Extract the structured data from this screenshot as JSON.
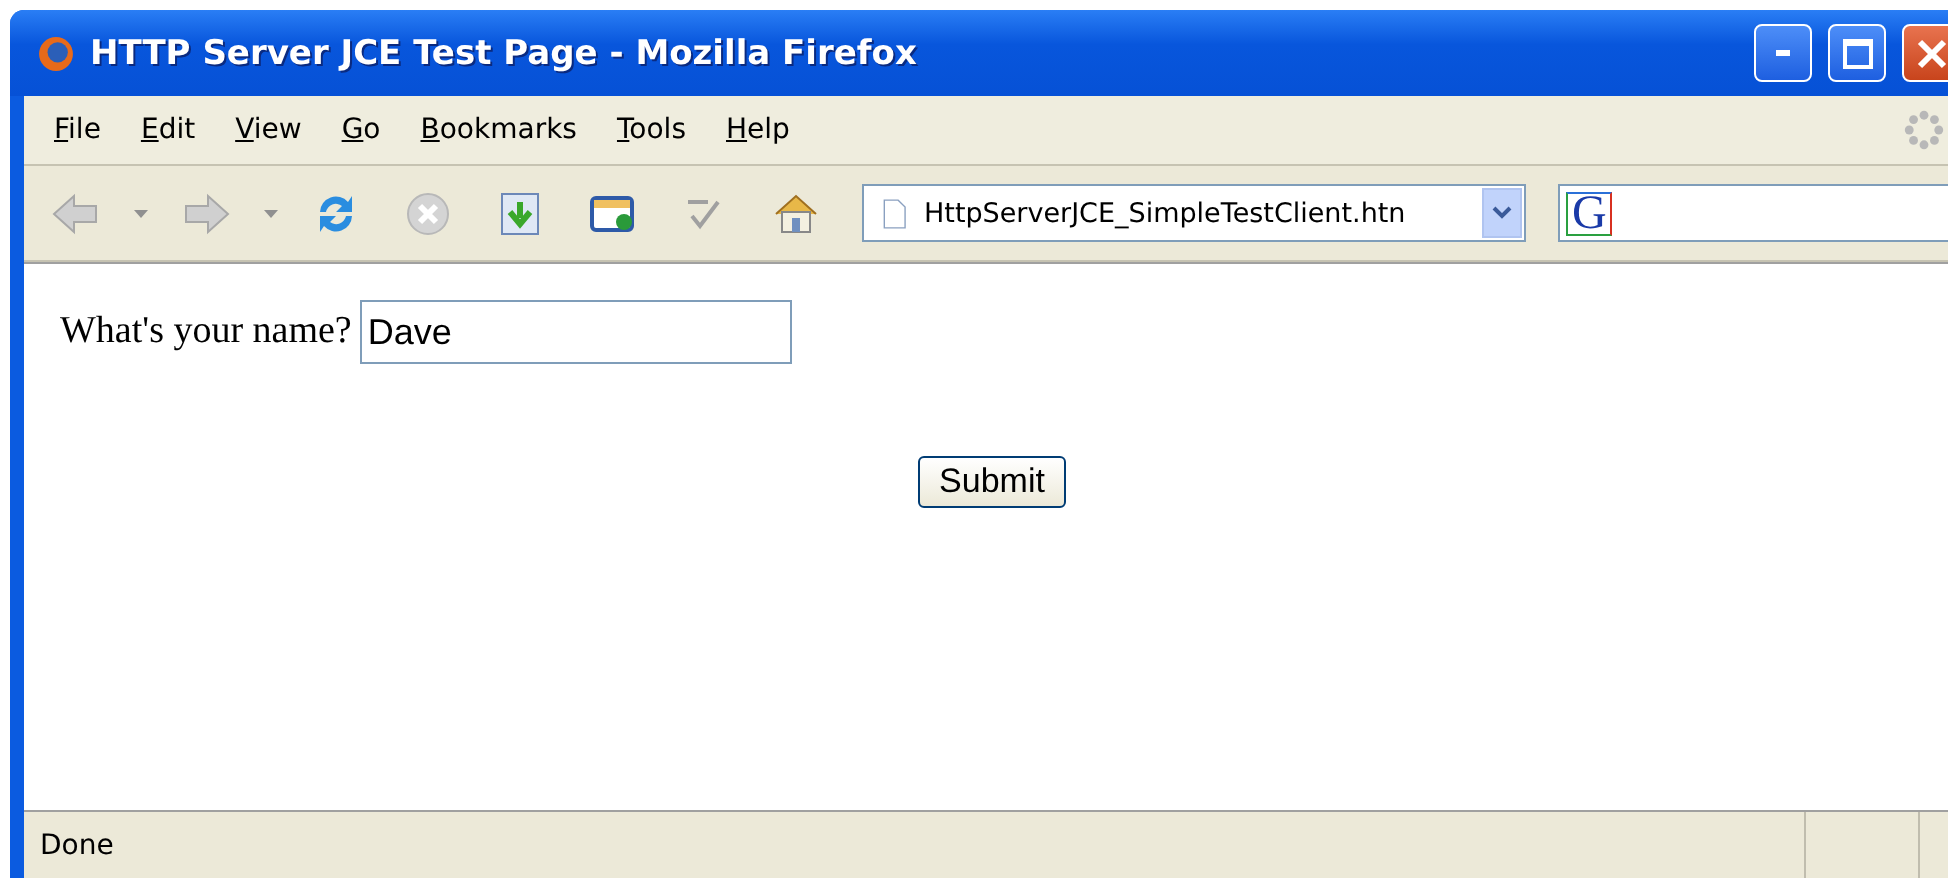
{
  "window": {
    "title": "HTTP Server JCE Test Page - Mozilla Firefox"
  },
  "menu": [
    "File",
    "Edit",
    "View",
    "Go",
    "Bookmarks",
    "Tools",
    "Help"
  ],
  "address_bar": {
    "value": "HttpServerJCE_SimpleTestClient.htn"
  },
  "search_bar": {
    "engine_label": "G"
  },
  "form": {
    "label": "What's your name?",
    "value": "Dave",
    "submit": "Submit"
  },
  "status_bar": {
    "text": "Done"
  }
}
